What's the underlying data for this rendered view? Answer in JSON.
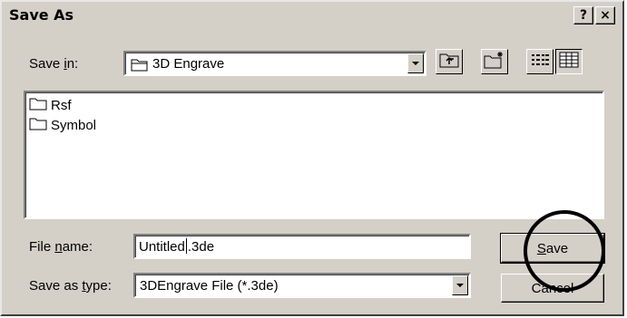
{
  "window": {
    "title": "Save As",
    "help_button": "?",
    "close_button": "×"
  },
  "save_in": {
    "label_pre": "Save ",
    "label_accel": "i",
    "label_post": "n:",
    "value": "3D Engrave"
  },
  "toolbar": {
    "up_icon": "up-one-level-icon",
    "new_folder_icon": "new-folder-icon",
    "list_icon": "list-view-icon",
    "details_icon": "details-view-icon"
  },
  "files": [
    {
      "name": "Rsf",
      "icon": "folder-icon"
    },
    {
      "name": "Symbol",
      "icon": "folder-icon"
    }
  ],
  "file_name": {
    "label_pre": "File ",
    "label_accel": "n",
    "label_post": "ame:",
    "value_before_caret": "Untitled",
    "value_after_caret": ".3de"
  },
  "save_as_type": {
    "label_pre": "Save as ",
    "label_accel": "t",
    "label_post": "ype:",
    "value": "3DEngrave File (*.3de)"
  },
  "buttons": {
    "save_accel": "S",
    "save_rest": "ave",
    "cancel": "Cancel"
  },
  "colors": {
    "face": "#d4d0c8",
    "highlight_ring": "#000000"
  }
}
